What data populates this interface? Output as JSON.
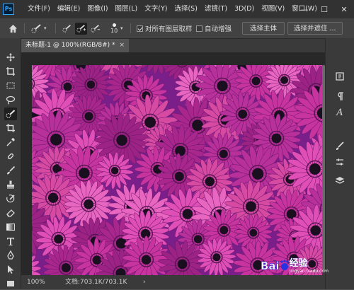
{
  "app": {
    "logo_text": "Ps"
  },
  "menu": [
    "文件(F)",
    "编辑(E)",
    "图像(I)",
    "图层(L)",
    "文字(Y)",
    "选择(S)",
    "滤镜(T)",
    "3D(D)",
    "视图(V)",
    "窗口(W)"
  ],
  "window_buttons": {
    "minimize": "—",
    "maximize": "☐",
    "close": "✕"
  },
  "options": {
    "brush_size": "10",
    "sample_all_layers_label": "对所有图层取样",
    "sample_all_layers_checked": true,
    "auto_enhance_label": "自动增强",
    "auto_enhance_checked": false,
    "select_subject_label": "选择主体",
    "select_and_mask_label": "选择并遮住 ..."
  },
  "document": {
    "tab_title": "未标题-1 @ 100%(RGB/8#) *",
    "close": "×"
  },
  "status": {
    "zoom": "100%",
    "doc_info": "文档:703.1K/703.1K",
    "arrow": "›"
  },
  "watermark": {
    "text": "Bai",
    "text2": "经验",
    "sub": "jingyan.baidu.com"
  },
  "colors": {
    "bg": "#535353",
    "panel": "#3a3a3a",
    "title": "#323232",
    "flower_base": "#7a1f8a",
    "flower_petal": "#d43aa8",
    "flower_center": "#1a0f1e"
  }
}
